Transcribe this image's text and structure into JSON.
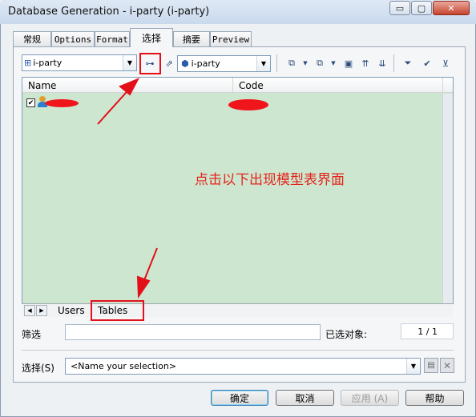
{
  "window": {
    "title": "Database Generation - i-party (i-party)",
    "controls": {
      "minimize": "▭",
      "maximize": "▢",
      "close": "✕"
    }
  },
  "tabs": [
    {
      "label": "常规"
    },
    {
      "label": "Options"
    },
    {
      "label": "Format"
    },
    {
      "label": "选择",
      "active": true
    },
    {
      "label": "摘要"
    },
    {
      "label": "Preview"
    }
  ],
  "toolbar": {
    "model_combo_value": "i-party",
    "package_combo_value": "i-party"
  },
  "list": {
    "columns": [
      "Name",
      "Code"
    ],
    "rows": [
      {
        "checked": true
      }
    ]
  },
  "annotation_text": "点击以下出现模型表界面",
  "bottom_tabs": [
    "Users",
    "Tables"
  ],
  "filter": {
    "label": "筛选",
    "value": "",
    "selected_label": "已选对象:",
    "selected_count": "1 / 1"
  },
  "selection": {
    "label": "选择(S)",
    "placeholder": "<Name your selection>"
  },
  "buttons": {
    "ok": "确定",
    "cancel": "取消",
    "apply": "应用 (A)",
    "help": "帮助"
  },
  "colors": {
    "list_background": "#cde6cf",
    "annotation": "#e5231a"
  }
}
